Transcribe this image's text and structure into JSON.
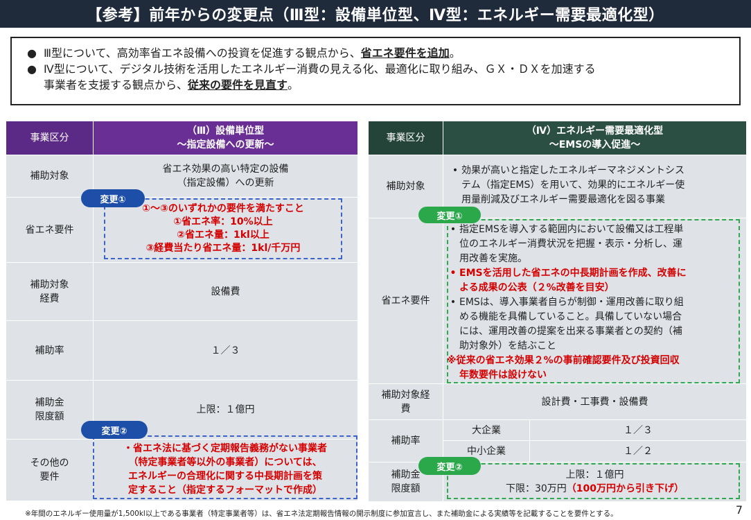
{
  "title": "【参考】前年からの変更点（Ⅲ型：設備単位型、Ⅳ型：エネルギー需要最適化型）",
  "summary": {
    "line1_pre": "Ⅲ型について、高効率省エネ設備への投資を促進する観点から、",
    "line1_bold": "省エネ要件を追加",
    "line1_post": "。",
    "line2_pre": "Ⅳ型について、デジタル技術を活用したエネルギー消費の見える化、最適化に取り組み、ＧＸ・ＤＸを加速する",
    "line3_pre": "事業者を支援する観点から、",
    "line3_bold": "従来の要件を見直す",
    "line3_post": "。"
  },
  "left_table": {
    "header_category": "事業区分",
    "header_title1": "（Ⅲ）設備単位型",
    "header_title2": "～指定設備への更新～",
    "row1_label": "補助対象",
    "row1_value1": "省エネ効果の高い特定の設備",
    "row1_value2": "（指定設備）への更新",
    "row2_label": "省エネ要件",
    "row2_red1": "①～③のいずれかの要件を満たすこと",
    "row2_red2": "①省エネ率：10%以上",
    "row2_red3": "②省エネ量：1kl以上",
    "row2_red4": "③経費当たり省エネ量：1kl/千万円",
    "row3_label1": "補助対象",
    "row3_label2": "経費",
    "row3_value": "設備費",
    "row4_label": "補助率",
    "row4_value": "１／３",
    "row5_label1": "補助金",
    "row5_label2": "限度額",
    "row5_value": "上限：１億円",
    "row6_label1": "その他の",
    "row6_label2": "要件",
    "row6_red1": "・省エネ法に基づく定期報告義務がない事業者",
    "row6_red2": "（特定事業者等以外の事業者）については、",
    "row6_red3": "エネルギーの合理化に関する中長期計画を策",
    "row6_red4": "定すること（指定するフォーマットで作成）",
    "badge1": "変更①",
    "badge2": "変更②"
  },
  "right_table": {
    "header_category": "事業区分",
    "header_title1": "（Ⅳ）エネルギー需要最適化型",
    "header_title2": "～EMSの導入促進～",
    "row1_label": "補助対象",
    "row1_text1": "効果が高いと指定したエネルギーマネジメントシス",
    "row1_text2": "テム（指定EMS）を用いて、効果的にエネルギー使",
    "row1_text3": "用量削減及びエネルギー需要最適化を図る事業",
    "row2_label": "省エネ要件",
    "row2_b1_1": "指定EMSを導入する範囲内において設備又は工程単",
    "row2_b1_2": "位のエネルギー消費状況を把握・表示・分析し、運",
    "row2_b1_3": "用改善を実施。",
    "row2_b2_1": "EMSを活用した省エネの中長期計画を作成、改善に",
    "row2_b2_2": "よる成果の公表（２%改善を目安）",
    "row2_b3_1": "EMSは、導入事業者自らが制御・運用改善に取り組",
    "row2_b3_2": "める機能を具備していること。具備していない場合",
    "row2_b3_3": "には、運用改善の提案を出来る事業者との契約（補",
    "row2_b3_4": "助対象外）を結ぶこと",
    "row2_note1": "※従来の省エネ効果２%の事前確認要件及び投資回収",
    "row2_note2": "年数要件は設けない",
    "row3_label1": "補助対象経",
    "row3_label2": "費",
    "row3_value": "設計費・工事費・設備費",
    "row4_label": "補助率",
    "row4_sub1": "大企業",
    "row4_val1": "１／３",
    "row4_sub2": "中小企業",
    "row4_val2": "１／２",
    "row5_label1": "補助金",
    "row5_label2": "限度額",
    "row5_val1": "上限：１億円",
    "row5_val2_pre": "下限：30万円",
    "row5_val2_red": "（100万円から引き下げ）",
    "badge1": "変更①",
    "badge2": "変更②"
  },
  "footnote": "※年間のエネルギー使用量が1,500kl以上である事業者（特定事業者等）は、省エネ法定期報告情報の開示制度に参加宣言し、また補助金による実績等を記載することを要件とする。",
  "page_number": "7",
  "colors": {
    "title_bg": "#1f2a3a",
    "left_header": "#6a2f94",
    "right_header": "#2c4f43",
    "cell_bg": "#dfe3e8",
    "accent_red": "#d40000",
    "badge_blue": "#1e4fa8",
    "badge_green": "#2aa84a"
  }
}
